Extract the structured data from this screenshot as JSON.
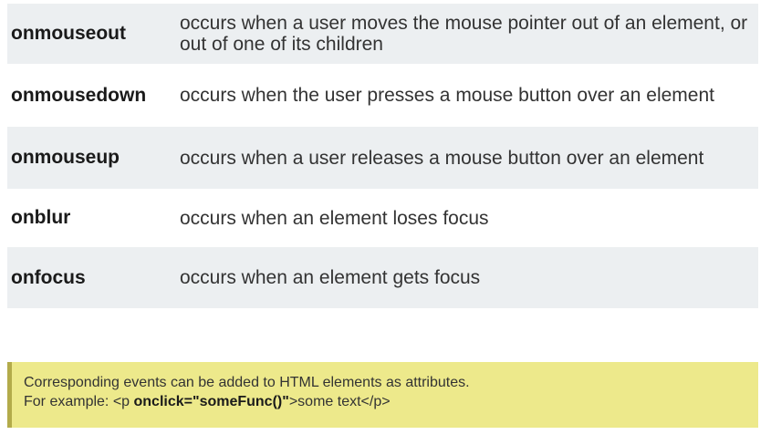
{
  "events": [
    {
      "name": "onmouseout",
      "description": "occurs when a user moves the mouse pointer out of an element, or out of one of its children"
    },
    {
      "name": "onmousedown",
      "description": "occurs when the user presses a mouse button over an element"
    },
    {
      "name": "onmouseup",
      "description": "occurs when a user releases a mouse button over an element"
    },
    {
      "name": "onblur",
      "description": "occurs when an element loses focus"
    },
    {
      "name": "onfocus",
      "description": "occurs when an element gets focus"
    }
  ],
  "note": {
    "line1": "Corresponding events can be added to HTML elements as attributes.",
    "line2_prefix": "For example: <p ",
    "line2_code": "onclick=\"someFunc()\"",
    "line2_suffix": ">some text</p>"
  },
  "colors": {
    "row_shaded": "#eceff1",
    "note_background": "#ede98b",
    "note_border": "#b3ab4a"
  }
}
